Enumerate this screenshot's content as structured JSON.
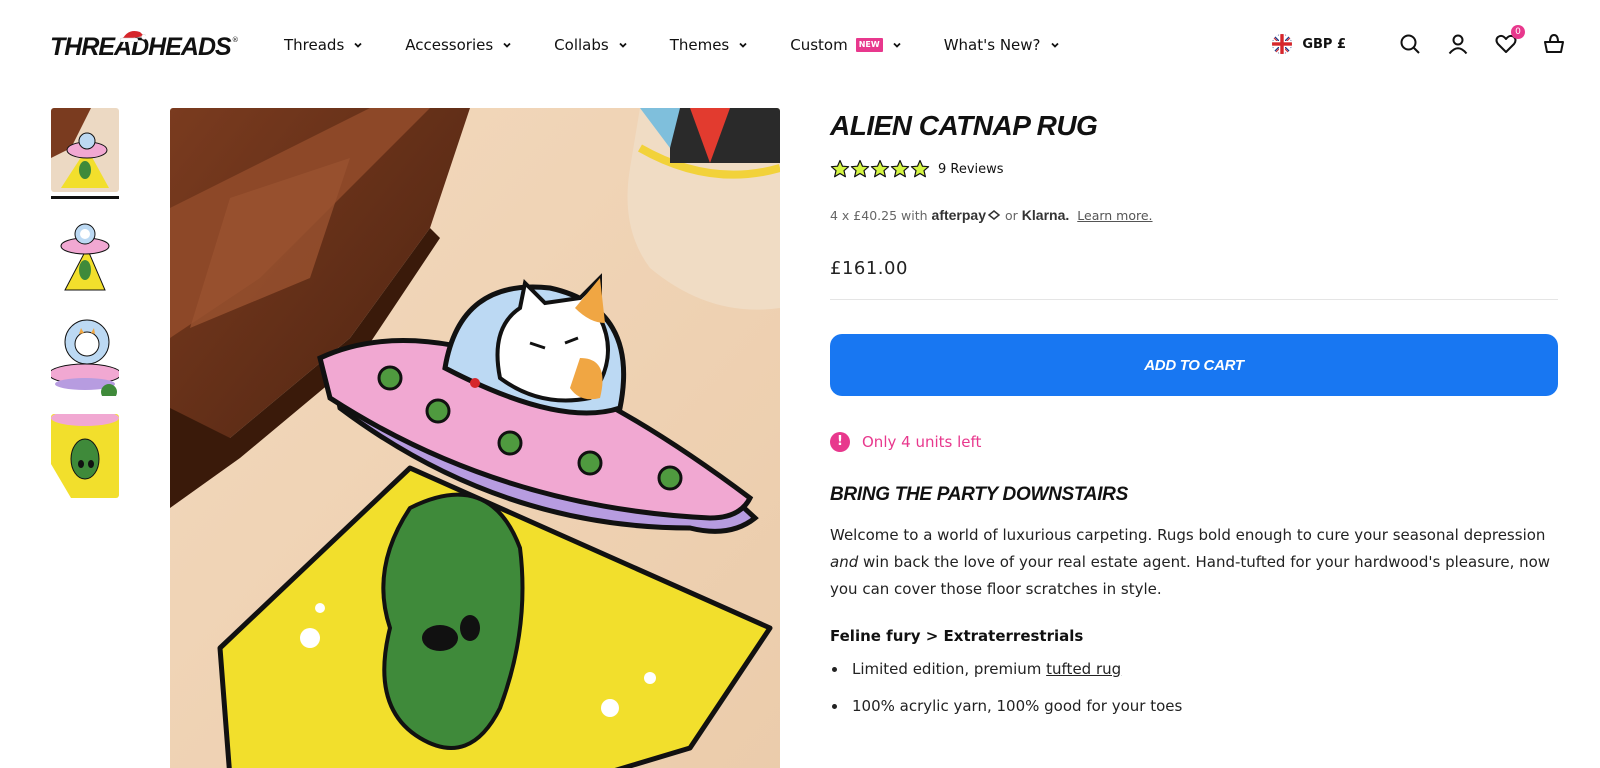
{
  "header": {
    "logo_text": "THREADHEADS",
    "nav": [
      {
        "label": "Threads"
      },
      {
        "label": "Accessories"
      },
      {
        "label": "Collabs"
      },
      {
        "label": "Themes"
      },
      {
        "label": "Custom",
        "badge": "NEW"
      },
      {
        "label": "What's New?"
      }
    ],
    "currency": "GBP £",
    "wishlist_count": "0"
  },
  "gallery": {
    "thumbnail_count": 4,
    "active_index": 0
  },
  "product": {
    "title": "ALIEN CATNAP RUG",
    "rating_stars": 5,
    "reviews": "9 Reviews",
    "installments": "4 x £40.25 with",
    "afterpay": "afterpay",
    "or": "or",
    "klarna": "Klarna.",
    "learn_more": "Learn more.",
    "price": "£161.00",
    "add_to_cart": "ADD TO CART",
    "stock_message": "Only 4 units left",
    "subheading": "BRING THE PARTY DOWNSTAIRS",
    "description_part1": "Welcome to a world of luxurious carpeting. Rugs bold enough to cure your seasonal depression ",
    "description_em": "and",
    "description_part2": " win back the love of your real estate agent. Hand-tufted for your hardwood's pleasure, now you can cover those floor scratches in style.",
    "feature_title": "Feline fury > Extraterrestrials",
    "bullet1_prefix": "Limited edition, premium ",
    "bullet1_link": "tufted rug",
    "bullet2": "100% acrylic yarn, 100% good for your toes"
  },
  "colors": {
    "accent_blue": "#1877f2",
    "accent_pink": "#e8388d",
    "star_yellow": "#d4f542"
  }
}
